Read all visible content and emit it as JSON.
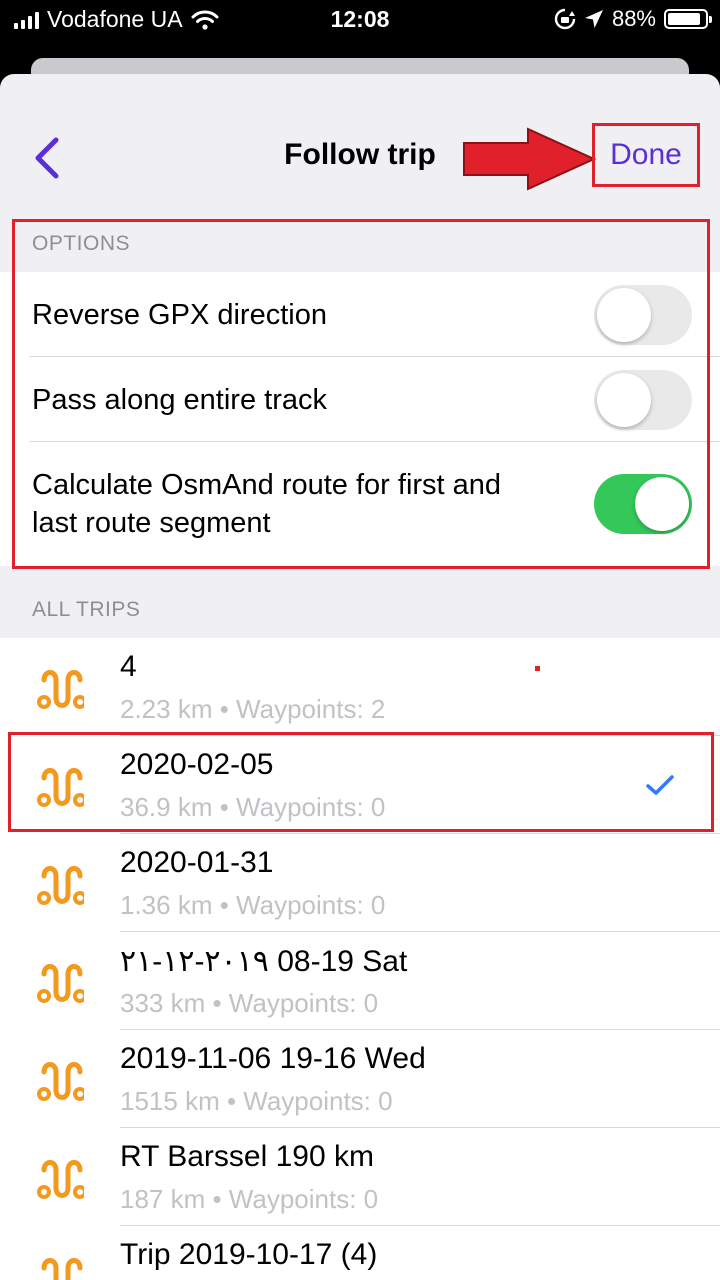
{
  "status_bar": {
    "carrier": "Vodafone UA",
    "time": "12:08",
    "battery": "88%",
    "battery_level": 0.88
  },
  "nav": {
    "title": "Follow trip",
    "done_label": "Done"
  },
  "options": {
    "header": "OPTIONS",
    "items": [
      {
        "label": "Reverse GPX direction",
        "on": false
      },
      {
        "label": "Pass along entire track",
        "on": false
      },
      {
        "label": "Calculate OsmAnd route for first and last route segment",
        "on": true
      }
    ]
  },
  "trips": {
    "header": "ALL TRIPS",
    "items": [
      {
        "name": "4",
        "meta": "2.23 km • Waypoints: 2",
        "selected": false
      },
      {
        "name": "2020-02-05",
        "meta": "36.9 km • Waypoints: 0",
        "selected": true
      },
      {
        "name": "2020-01-31",
        "meta": "1.36 km • Waypoints: 0",
        "selected": false
      },
      {
        "name": "۲۱-۱۲-۲۰۱۹ 08-19 Sat",
        "meta": "333 km • Waypoints: 0",
        "selected": false
      },
      {
        "name": "2019-11-06 19-16 Wed",
        "meta": "1515 km • Waypoints: 0",
        "selected": false
      },
      {
        "name": "RT Barssel 190 km",
        "meta": "187 km • Waypoints: 0",
        "selected": false
      },
      {
        "name": "Trip 2019-10-17 (4)",
        "meta": "",
        "selected": false
      }
    ]
  },
  "colors": {
    "accent": "#5b2fd6",
    "toggle_on": "#34c759",
    "route_icon": "#f39a1e",
    "highlight": "#e0202a",
    "check": "#2f7cf6"
  }
}
